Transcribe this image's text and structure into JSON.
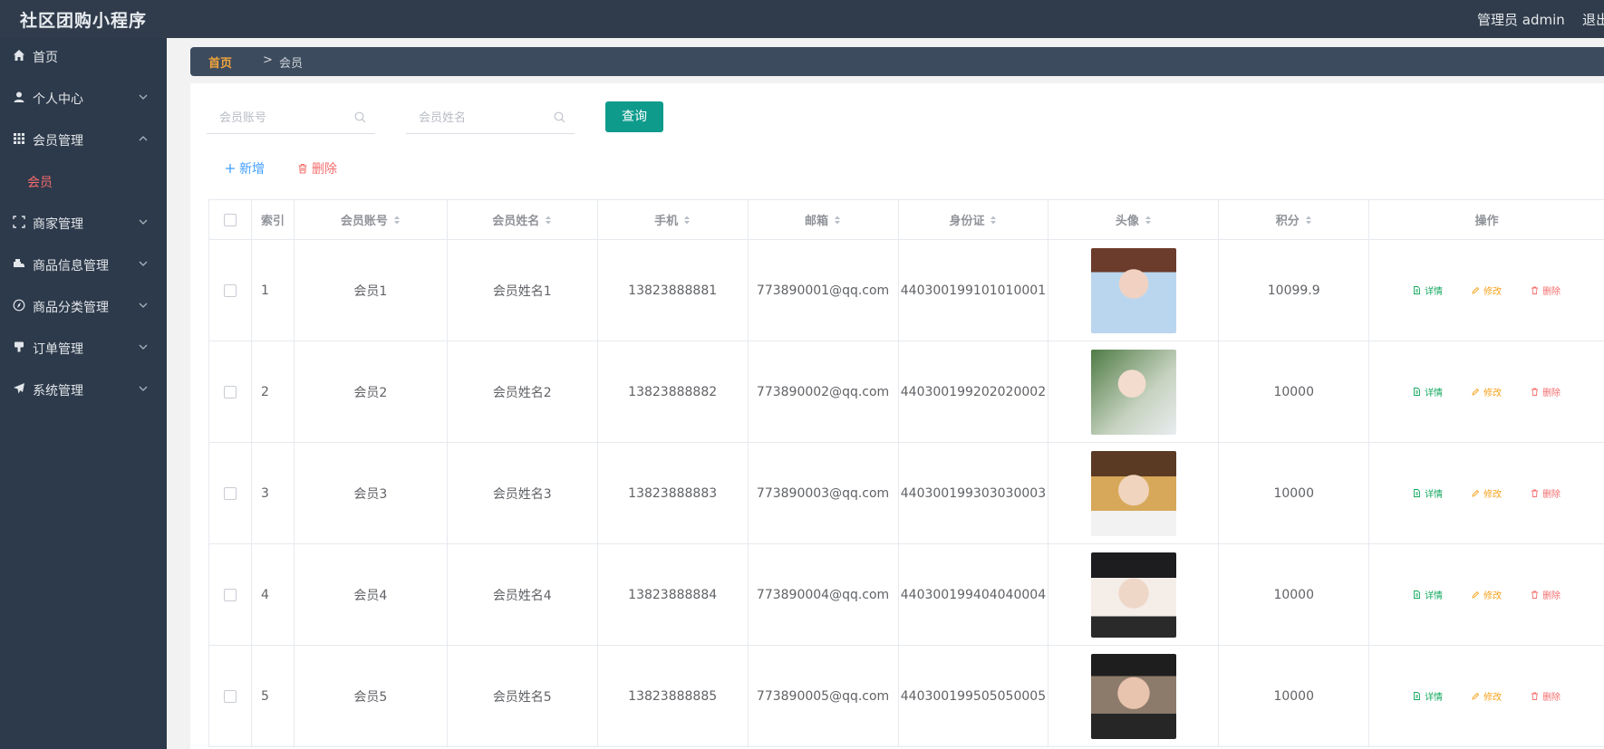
{
  "header": {
    "app_title": "社区团购小程序",
    "admin_label": "管理员 admin",
    "logout_label": "退出登录"
  },
  "sidebar": {
    "items": [
      {
        "label": "首页",
        "icon": "home-icon"
      },
      {
        "label": "个人中心",
        "icon": "user-icon"
      },
      {
        "label": "会员管理",
        "icon": "grid-icon"
      },
      {
        "label": "商家管理",
        "icon": "frame-icon"
      },
      {
        "label": "商品信息管理",
        "icon": "truck-icon"
      },
      {
        "label": "商品分类管理",
        "icon": "compass-icon"
      },
      {
        "label": "订单管理",
        "icon": "cup-icon"
      },
      {
        "label": "系统管理",
        "icon": "plane-icon"
      }
    ],
    "sub_item": "会员"
  },
  "breadcrumb": {
    "home": "首页",
    "separator": ">",
    "current": "会员"
  },
  "search": {
    "account_placeholder": "会员账号",
    "name_placeholder": "会员姓名",
    "query_label": "查询"
  },
  "actions": {
    "add_label": "新增",
    "delete_label": "删除"
  },
  "table": {
    "headers": {
      "index": "索引",
      "account": "会员账号",
      "name": "会员姓名",
      "phone": "手机",
      "email": "邮箱",
      "idcard": "身份证",
      "avatar": "头像",
      "score": "积分",
      "ops": "操作"
    },
    "ops_labels": {
      "detail": "详情",
      "edit": "修改",
      "delete": "删除"
    },
    "rows": [
      {
        "index": "1",
        "account": "会员1",
        "name": "会员姓名1",
        "phone": "13823888881",
        "email": "773890001@qq.com",
        "idcard": "440300199101010001",
        "score": "10099.9"
      },
      {
        "index": "2",
        "account": "会员2",
        "name": "会员姓名2",
        "phone": "13823888882",
        "email": "773890002@qq.com",
        "idcard": "440300199202020002",
        "score": "10000"
      },
      {
        "index": "3",
        "account": "会员3",
        "name": "会员姓名3",
        "phone": "13823888883",
        "email": "773890003@qq.com",
        "idcard": "440300199303030003",
        "score": "10000"
      },
      {
        "index": "4",
        "account": "会员4",
        "name": "会员姓名4",
        "phone": "13823888884",
        "email": "773890004@qq.com",
        "idcard": "440300199404040004",
        "score": "10000"
      },
      {
        "index": "5",
        "account": "会员5",
        "name": "会员姓名5",
        "phone": "13823888885",
        "email": "773890005@qq.com",
        "idcard": "440300199505050005",
        "score": "10000"
      }
    ]
  },
  "colors": {
    "header_bg": "#303c4b",
    "sidebar_bg": "#2d3a4b",
    "accent_teal": "#0e9b8c",
    "active_red": "#f56c6c",
    "breadcrumb_bg": "#3d4b5e"
  }
}
